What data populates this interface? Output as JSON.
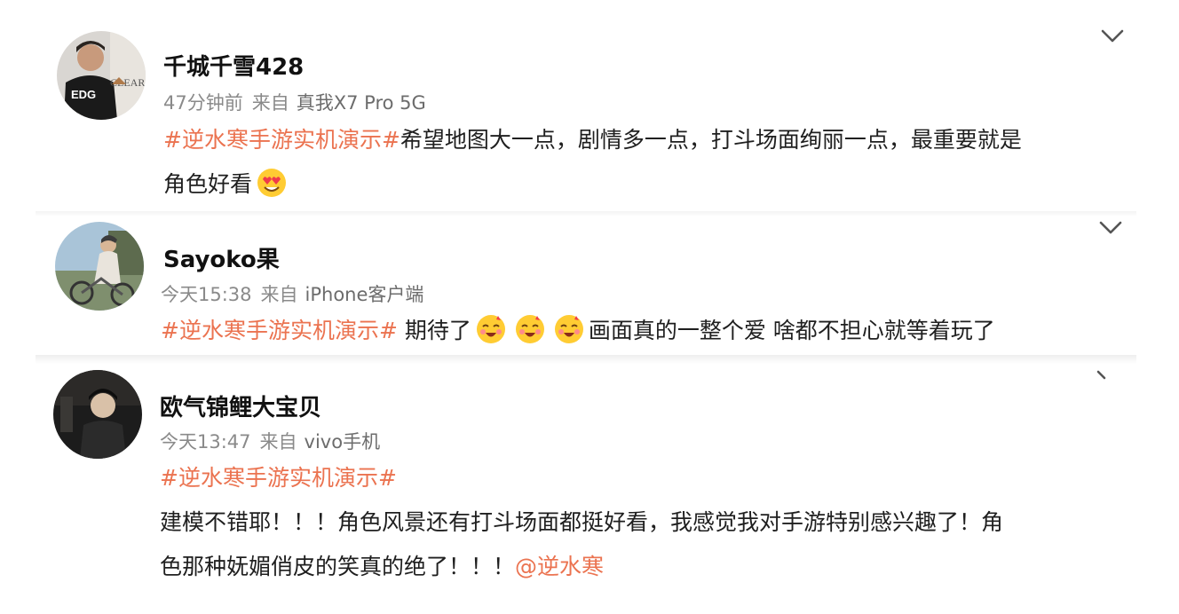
{
  "posts": [
    {
      "username": "千城千雪428",
      "time": "47分钟前",
      "from_label": "来自",
      "source": "真我X7 Pro 5G",
      "hashtag": "#逆水寒手游实机演示#",
      "text_line1": "希望地图大一点，剧情多一点，打斗场面绚丽一点，最重要就是",
      "text_line2": "角色好看",
      "emojis": [
        "heart-eyes-emoji"
      ],
      "avatar_badge": "EDG",
      "avatar_side_text": "CLEAR"
    },
    {
      "username": "Sayoko果",
      "time": "今天15:38",
      "from_label": "来自",
      "source": "iPhone客户端",
      "hashtag": "#逆水寒手游实机演示#",
      "text_before_emoji": " 期待了",
      "text_after_emoji": "画面真的一整个爱 啥都不担心就等着玩了",
      "emojis": [
        "happy-emoji",
        "happy-emoji",
        "happy-emoji"
      ]
    },
    {
      "username": "欧气锦鲤大宝贝",
      "time": "今天13:47",
      "from_label": "来自",
      "source": "vivo手机",
      "hashtag": "#逆水寒手游实机演示#",
      "text_line1": "建模不错耶！！！角色风景还有打斗场面都挺好看，我感觉我对手游特别感兴趣了！角",
      "text_line2": "色那种妩媚俏皮的笑真的绝了！！！",
      "mention": "@逆水寒"
    }
  ],
  "colors": {
    "link": "#eb7350",
    "meta": "#8a8a8a",
    "text": "#1f1f1f"
  },
  "icons": {
    "more": "chevron-down-icon"
  }
}
